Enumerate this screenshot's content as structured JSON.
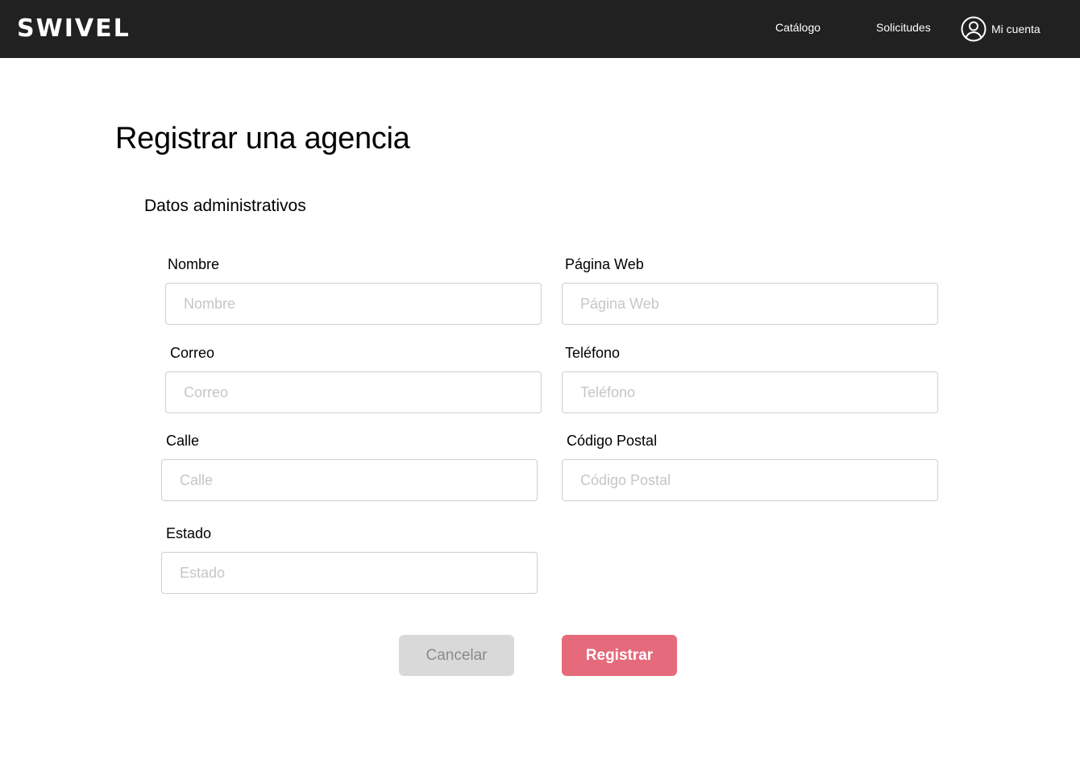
{
  "brand": {
    "logo_text": "SWIVEL"
  },
  "nav": {
    "items": [
      {
        "label": "Catálogo"
      },
      {
        "label": "Solicitudes"
      }
    ],
    "account": {
      "label": "Mi cuenta",
      "icon": "user-circle-icon"
    }
  },
  "page": {
    "title": "Registrar una agencia",
    "section_title": "Datos administrativos"
  },
  "form": {
    "fields": {
      "nombre": {
        "label": "Nombre",
        "placeholder": "Nombre",
        "value": ""
      },
      "pagina_web": {
        "label": "Página Web",
        "placeholder": "Página Web",
        "value": ""
      },
      "correo": {
        "label": "Correo",
        "placeholder": "Correo",
        "value": ""
      },
      "telefono": {
        "label": "Teléfono",
        "placeholder": "Teléfono",
        "value": ""
      },
      "calle": {
        "label": "Calle",
        "placeholder": "Calle",
        "value": ""
      },
      "codigo_postal": {
        "label": "Código Postal",
        "placeholder": "Código Postal",
        "value": ""
      },
      "estado": {
        "label": "Estado",
        "placeholder": "Estado",
        "value": ""
      }
    },
    "buttons": {
      "cancel_label": "Cancelar",
      "submit_label": "Registrar"
    }
  },
  "colors": {
    "topbar_bg": "#212121",
    "accent": "#e56a7c",
    "cancel_bg": "#d9d9d9",
    "input_border": "#cfcfcf",
    "placeholder": "#c6c6c6"
  }
}
